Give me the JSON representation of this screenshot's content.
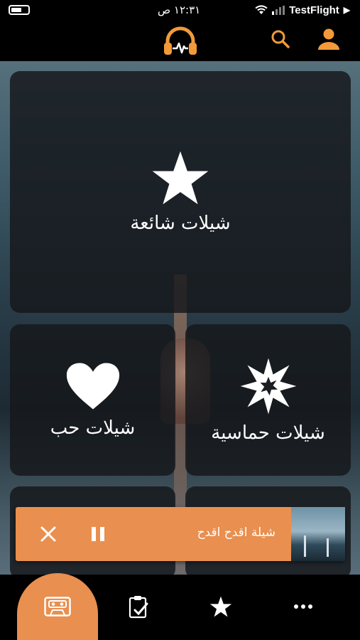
{
  "status_bar": {
    "time": "١٢:٣١ ص",
    "carrier": "TestFlight",
    "carrier_arrow": "▶"
  },
  "header": {
    "logo_icon": "headphones-waveform-icon",
    "search_icon": "search-icon",
    "profile_icon": "user-icon",
    "accent_color": "#f29a3a"
  },
  "categories": {
    "popular": {
      "label": "شيلات شائعة",
      "icon": "star-icon"
    },
    "hype": {
      "label": "شيلات حماسية",
      "icon": "starburst-icon"
    },
    "love": {
      "label": "شيلات حب",
      "icon": "heart-icon"
    }
  },
  "player": {
    "track_title": "شيلة اقدح اقدح",
    "pause_icon": "pause-icon",
    "close_icon": "close-icon",
    "background_color": "#e98f4f"
  },
  "bottom_nav": {
    "items": [
      {
        "icon": "cassette-icon",
        "active": true
      },
      {
        "icon": "clipboard-check-icon",
        "active": false
      },
      {
        "icon": "star-icon",
        "active": false
      },
      {
        "icon": "more-dots-icon",
        "active": false
      }
    ]
  }
}
